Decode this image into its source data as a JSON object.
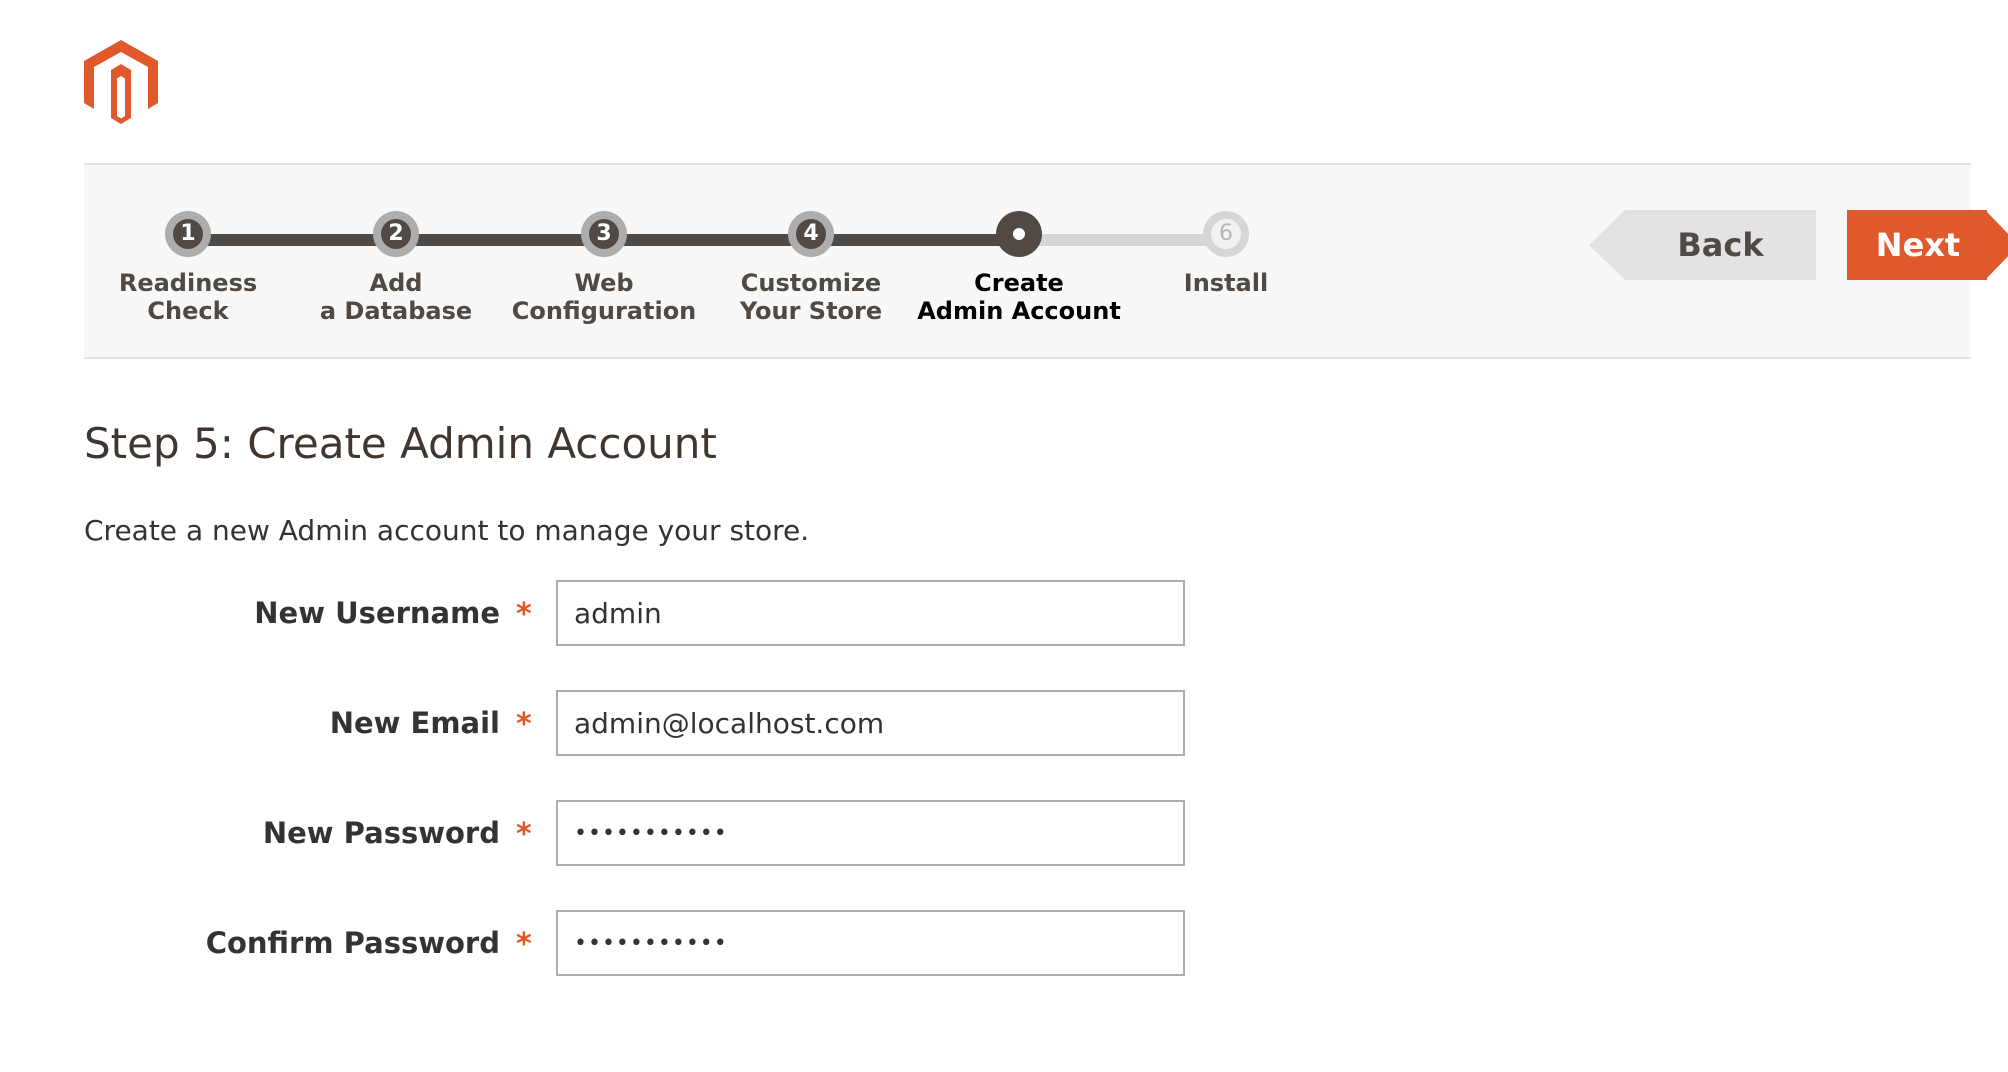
{
  "header": {
    "logo_icon": "magento-logo-icon",
    "brand_color": "#e0592a"
  },
  "progress": {
    "steps": [
      {
        "number": "1",
        "label": "Readiness\nCheck",
        "state": "complete"
      },
      {
        "number": "2",
        "label": "Add\na Database",
        "state": "complete"
      },
      {
        "number": "3",
        "label": "Web\nConfiguration",
        "state": "complete"
      },
      {
        "number": "4",
        "label": "Customize\nYour Store",
        "state": "complete"
      },
      {
        "number": "",
        "label": "Create\nAdmin Account",
        "state": "current"
      },
      {
        "number": "6",
        "label": "Install",
        "state": "todo"
      }
    ]
  },
  "buttons": {
    "back_label": "Back",
    "next_label": "Next"
  },
  "main": {
    "title": "Step 5: Create Admin Account",
    "intro": "Create a new Admin account to manage your store.",
    "required_marker": "*",
    "fields": [
      {
        "label": "New Username",
        "value": "admin",
        "type": "text"
      },
      {
        "label": "New Email",
        "value": "admin@localhost.com",
        "type": "text"
      },
      {
        "label": "New Password",
        "value": "•••••••••••",
        "type": "password"
      },
      {
        "label": "Confirm Password",
        "value": "•••••••••••",
        "type": "password"
      }
    ]
  }
}
